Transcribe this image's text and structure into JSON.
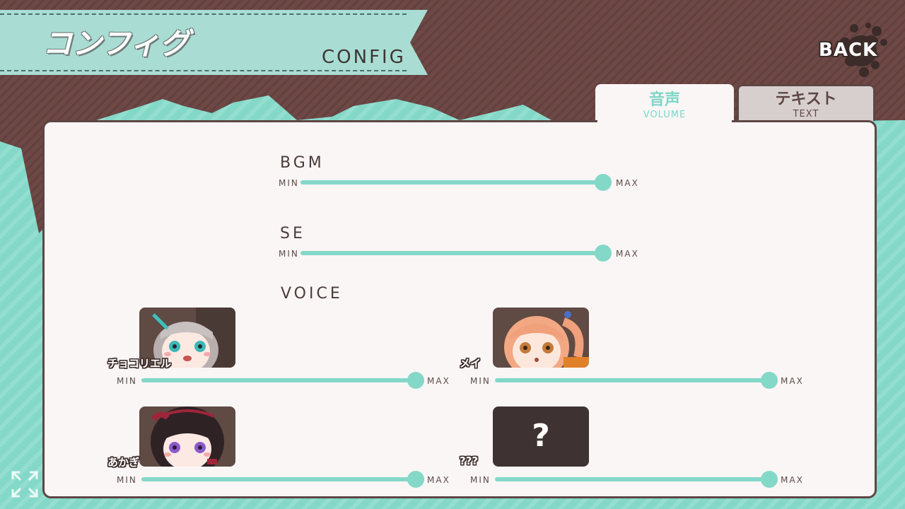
{
  "title": {
    "jp": "コンフィグ",
    "en": "CONFIG"
  },
  "back_button": {
    "label": "BACK"
  },
  "tabs": [
    {
      "jp": "音声",
      "en": "VOLUME",
      "active": true
    },
    {
      "jp": "テキスト",
      "en": "TEXT",
      "active": false
    }
  ],
  "labels": {
    "min": "MIN",
    "max": "MAX"
  },
  "bgm": {
    "label": "BGM",
    "level": 1.0
  },
  "se": {
    "label": "SE",
    "level": 1.0
  },
  "voice": {
    "label": "VOICE",
    "characters": [
      {
        "name": "チョコリエル",
        "level": 1.0
      },
      {
        "name": "メイ",
        "level": 1.0
      },
      {
        "name": "あかぎ",
        "level": 1.0
      },
      {
        "name": "???",
        "level": 1.0,
        "locked_symbol": "?"
      }
    ]
  },
  "colors": {
    "accent": "#84d8c8",
    "brown": "#6a4541",
    "panel": "#faf6f5",
    "dark": "#3e3332"
  },
  "icons": {
    "fullscreen": "expand-arrows-icon",
    "back": "ink-splat-icon"
  }
}
